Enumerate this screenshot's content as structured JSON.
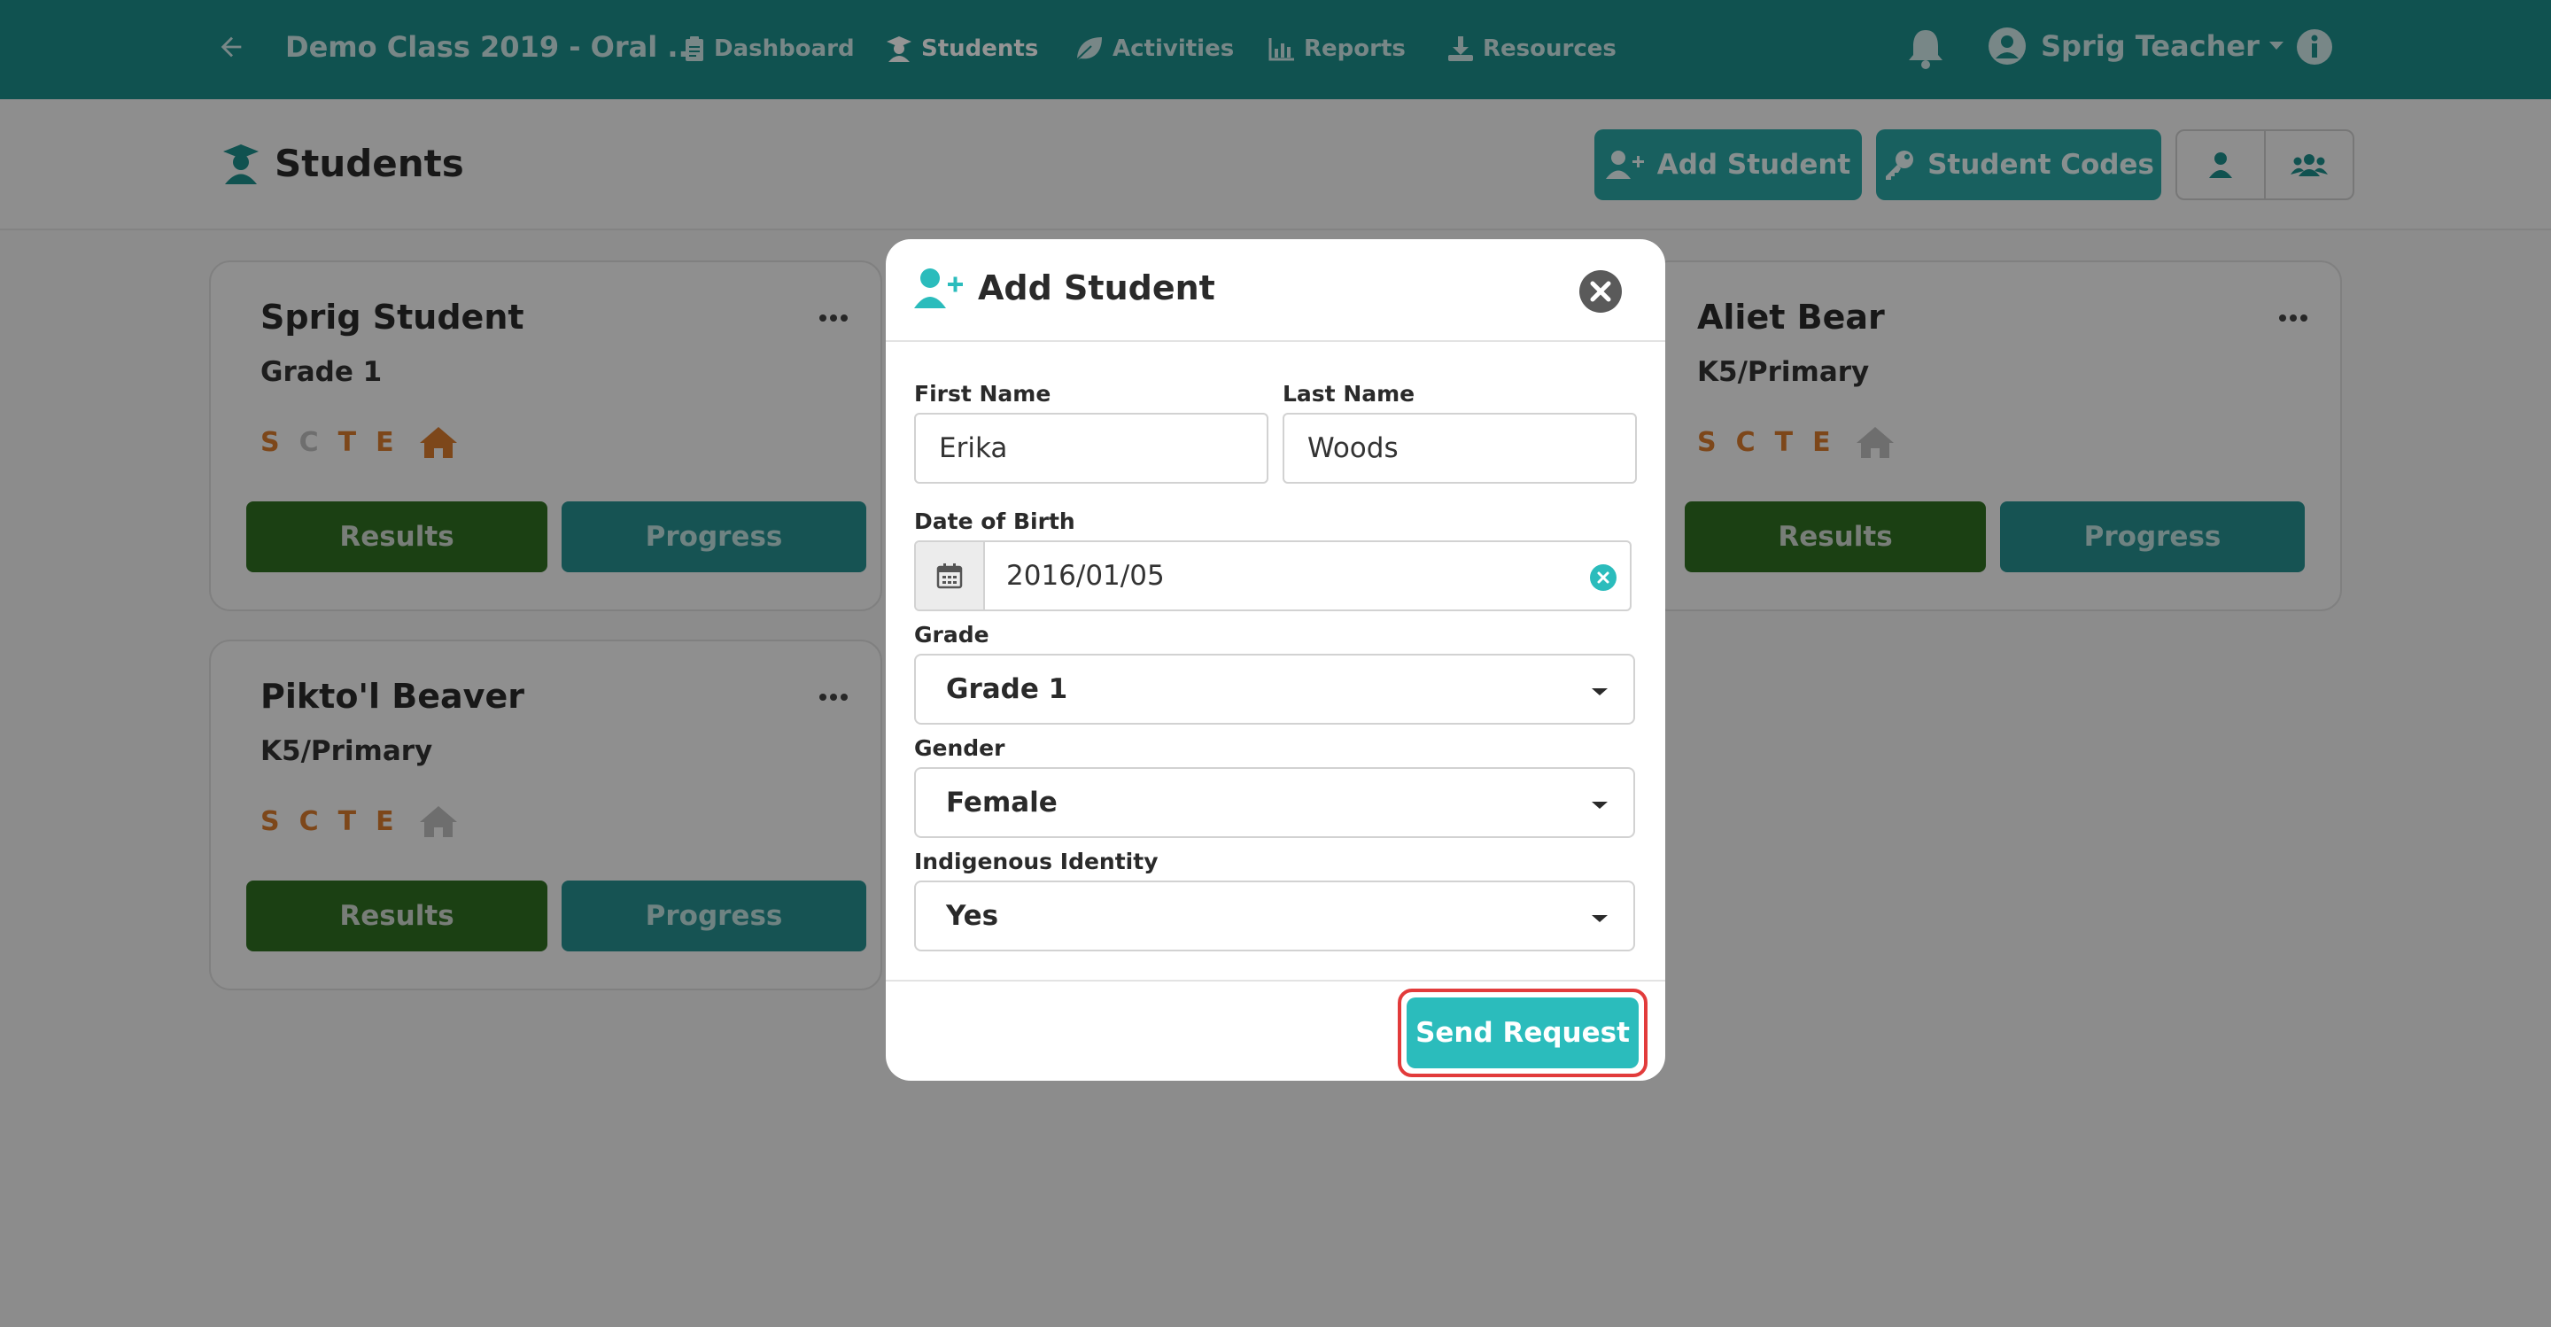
{
  "nav": {
    "class_title": "Demo Class 2019 - Oral ...",
    "items": [
      {
        "label": "Dashboard",
        "icon": "clipboard-icon"
      },
      {
        "label": "Students",
        "icon": "student-icon"
      },
      {
        "label": "Activities",
        "icon": "leaf-icon"
      },
      {
        "label": "Reports",
        "icon": "bar-chart-icon"
      },
      {
        "label": "Resources",
        "icon": "download-icon"
      }
    ],
    "user_name": "Sprig Teacher"
  },
  "header": {
    "title": "Students",
    "add_student_label": "Add Student",
    "student_codes_label": "Student Codes"
  },
  "students": [
    {
      "name": "Sprig Student",
      "grade": "Grade 1",
      "scte": [
        "S",
        "C",
        "T",
        "E"
      ],
      "results_label": "Results",
      "progress_label": "Progress"
    },
    {
      "name": "Aliet Bear",
      "grade": "K5/Primary",
      "scte": [
        "S",
        "C",
        "T",
        "E"
      ],
      "results_label": "Results",
      "progress_label": "Progress"
    },
    {
      "name": "Pikto'l Beaver",
      "grade": "K5/Primary",
      "scte": [
        "S",
        "C",
        "T",
        "E"
      ],
      "results_label": "Results",
      "progress_label": "Progress"
    }
  ],
  "modal": {
    "title": "Add Student",
    "first_name_label": "First Name",
    "first_name_value": "Erika",
    "last_name_label": "Last Name",
    "last_name_value": "Woods",
    "dob_label": "Date of Birth",
    "dob_value": "2016/01/05",
    "grade_label": "Grade",
    "grade_value": "Grade 1",
    "gender_label": "Gender",
    "gender_value": "Female",
    "indigenous_label": "Indigenous Identity",
    "indigenous_value": "Yes",
    "submit_label": "Send Request"
  },
  "colors": {
    "nav_bg": "#1d8d8b",
    "results_button": "#2f6f22",
    "progress_button": "#27908f",
    "send_button": "#2bbcbc",
    "highlight_ring": "#e23b3b",
    "scte_active": "#d77b2e"
  }
}
